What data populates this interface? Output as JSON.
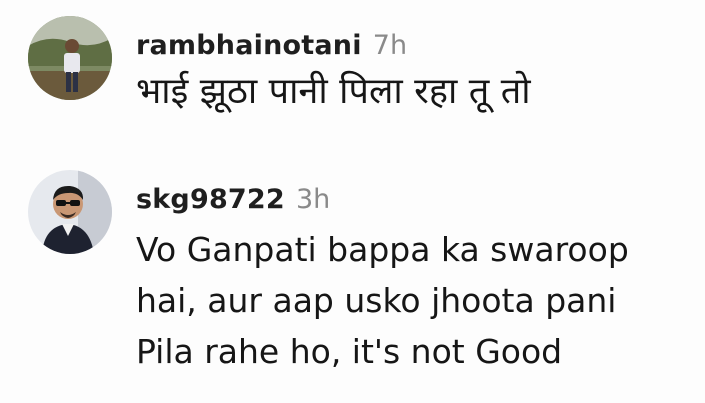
{
  "comments": [
    {
      "username": "rambhainotani",
      "time": "7h",
      "text": "भाई झूठा पानी पिला रहा तू तो",
      "avatar_icon": "avatar-person-outdoor"
    },
    {
      "username": "skg98722",
      "time": "3h",
      "text": "Vo Ganpati bappa ka swaroop\nhai, aur aap usko jhoota pani\nPila rahe ho, it's not Good",
      "avatar_icon": "avatar-person-sunglasses"
    }
  ]
}
